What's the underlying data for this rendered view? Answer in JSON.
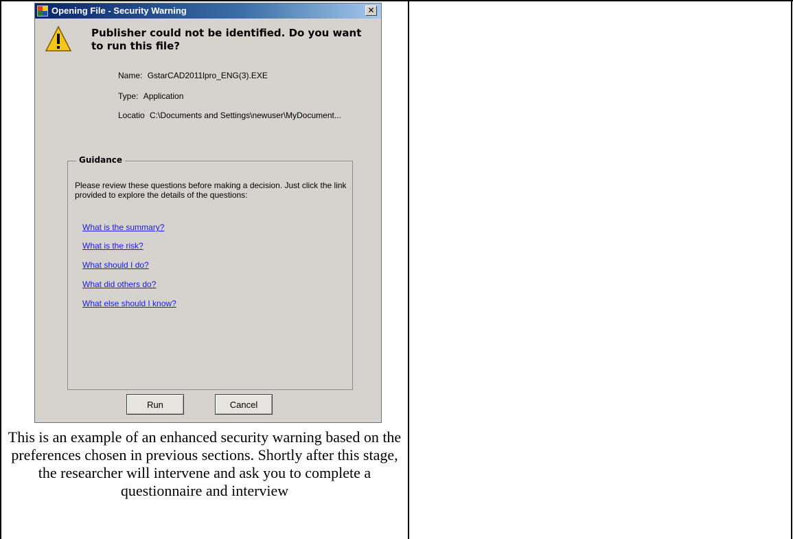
{
  "dialog": {
    "title": "Opening File - Security Warning",
    "close_glyph": "✕",
    "headline": "Publisher could not be identified. Do you want to run this file?",
    "fields": [
      {
        "label": "Name:",
        "value": "GstarCAD2011lpro_ENG(3).EXE"
      },
      {
        "label": "Type:",
        "value": "Application"
      },
      {
        "label": "Locatio",
        "value": "C:\\Documents and Settings\\newuser\\MyDocument..."
      }
    ],
    "guidance": {
      "legend": "Guidance",
      "description": "Please review these questions before making a decision. Just click the link provided to explore the details of the questions:",
      "links": [
        "What is the summary?",
        "What is the risk?",
        "What should I do?",
        "What did others do?",
        "What else should I know?"
      ]
    },
    "buttons": {
      "run": "Run",
      "cancel": "Cancel"
    },
    "icons": {
      "app": "window-app-icon",
      "warning": "warning-triangle-icon",
      "close": "close-icon"
    }
  },
  "caption": "This is an example of an enhanced security warning based on the preferences chosen in previous sections.  Shortly after this stage, the researcher will intervene and ask you to complete a questionnaire and interview",
  "colors": {
    "titlebar_start": "#0a246a",
    "dialog_face": "#d6d3ce",
    "link": "#1a1ae6",
    "warning_yellow": "#f5c518"
  }
}
